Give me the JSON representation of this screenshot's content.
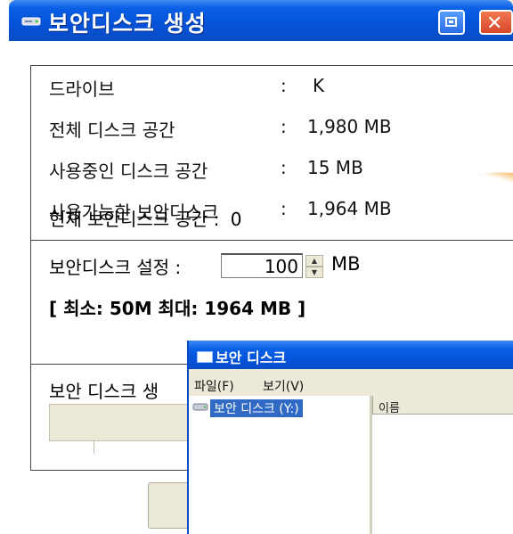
{
  "window": {
    "title": "보안디스크 생성"
  },
  "info": {
    "drive_label": "드라이브",
    "drive_value": "K",
    "total_label": "전체 디스크 공간",
    "total_value": "1,980 MB",
    "used_label": "사용중인  디스크 공간",
    "used_value": "15 MB",
    "available_label": "사용가능한 보안디스크",
    "available_value": "1,964 MB",
    "colon": ":"
  },
  "settings": {
    "current_label": "현재 보안디스크 공간 :",
    "current_value": "0",
    "size_label": "보안디스크 설정 :",
    "size_value": "100",
    "size_unit": "MB",
    "range_text": "[ 최소: 50M    최대: 1964 MB ]"
  },
  "progress": {
    "label": "보안 디스크 생"
  },
  "explorer": {
    "title": "보안 디스크",
    "menu": [
      "파일(F)",
      "보기(V)"
    ],
    "tree_item": "보안 디스크 (Y:)",
    "column_name": "이름"
  },
  "icons": {
    "titlebar": "drive-icon",
    "tree": "drive-icon"
  }
}
